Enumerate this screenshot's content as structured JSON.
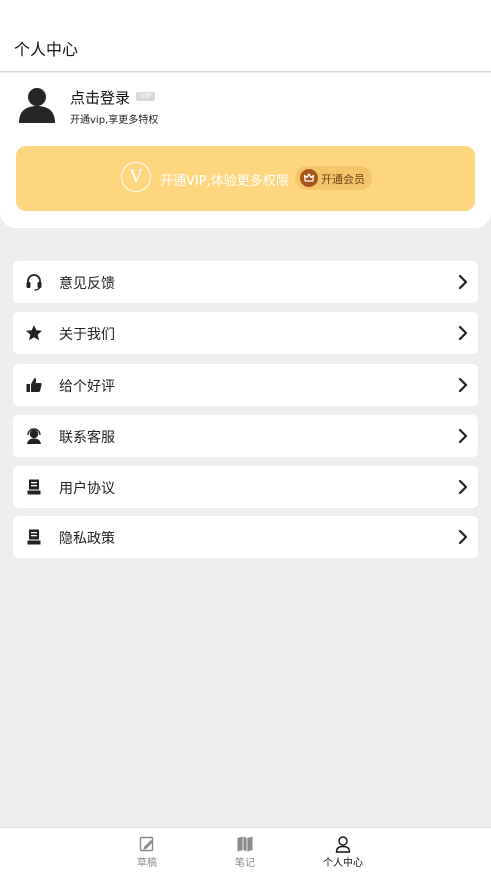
{
  "header": {
    "title": "个人中心"
  },
  "profile": {
    "login_label": "点击登录",
    "vip_tag": "VIP",
    "subtitle": "开通vip,享更多特权"
  },
  "vip_card": {
    "logo_letter": "V",
    "text": "开通VIP,体验更多权限",
    "button_label": "开通会员",
    "background": "#fdd67f"
  },
  "menu": {
    "items": [
      {
        "label": "意见反馈",
        "icon": "headset-icon"
      },
      {
        "label": "关于我们",
        "icon": "star-icon"
      },
      {
        "label": "给个好评",
        "icon": "thumbs-up-icon"
      },
      {
        "label": "联系客服",
        "icon": "customer-service-icon"
      },
      {
        "label": "用户协议",
        "icon": "document-icon"
      },
      {
        "label": "隐私政策",
        "icon": "document-icon"
      }
    ]
  },
  "tabbar": {
    "tabs": [
      {
        "label": "草稿",
        "icon": "draft-icon",
        "active": false
      },
      {
        "label": "笔记",
        "icon": "notebook-icon",
        "active": false
      },
      {
        "label": "个人中心",
        "icon": "person-icon",
        "active": true
      }
    ]
  }
}
